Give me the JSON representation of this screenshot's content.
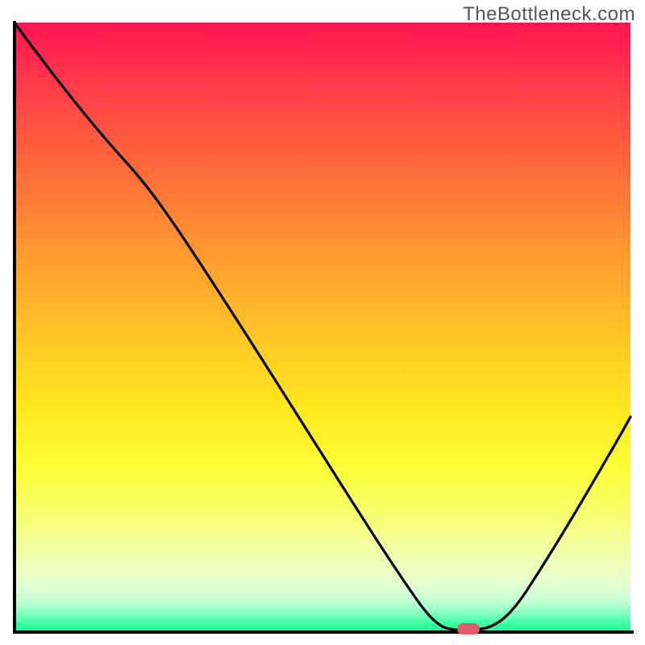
{
  "watermark": {
    "text": "TheBottleneck.com"
  },
  "chart_data": {
    "type": "line",
    "title": "",
    "xlabel": "",
    "ylabel": "",
    "xlim": [
      0,
      100
    ],
    "ylim": [
      0,
      100
    ],
    "x": [
      0,
      5,
      10,
      16,
      22,
      28,
      34,
      40,
      46,
      52,
      58,
      63,
      67,
      70,
      73,
      76,
      80,
      85,
      90,
      95,
      100
    ],
    "values": [
      100,
      94,
      88,
      82,
      74,
      65,
      56,
      47,
      38,
      29,
      20,
      12,
      6,
      2,
      0,
      0,
      3,
      10,
      20,
      31,
      43
    ],
    "series": [
      {
        "name": "bottleneck-curve",
        "color": "#000000"
      }
    ],
    "marker": {
      "x": 74.5,
      "y": 0,
      "color": "#e05a6a"
    },
    "background_gradient": {
      "top": "#ff1452",
      "mid": "#ffe91f",
      "bottom": "#1aff94"
    }
  }
}
